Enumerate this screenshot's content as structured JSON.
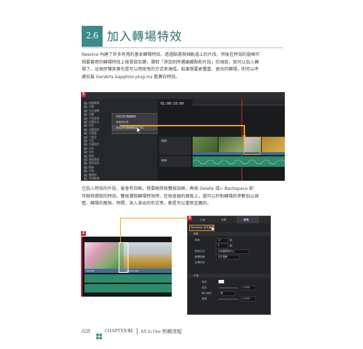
{
  "section": {
    "number": "2.6",
    "title": "加入轉場特效"
  },
  "paragraph1": [
    "Resolve 內建了許多有用的基本轉場特效。透過點選視頻軌道上的片段，然後在特效的窗格中",
    "想要套用的轉場特效上按滑鼠右鍵，選取「添加到所選編輯點和片段」的項目，就可以加入轉",
    "場了。這個步驟其實也是可以用拖曳的方式來達成。如果想要更豐富、更炫的轉場，則可以考",
    "慮安裝 GenArts Sapphire plug-ins 藍寶石特效。"
  ],
  "paragraph2": [
    "已加入特效的片段，後會有白框。想要刪除就雙按該框，再按 Delete 或← Backspace 即",
    "可刪除選取的特效。雙按選取轉場特效時，在檢查器的面板上，還可以針對轉場的參數加以調",
    "整，轉場的風格、時間、漸入漸出的形式等，都是可以重新定義的。"
  ],
  "figure1": {
    "tag": "1",
    "timecode": "01:00:10:00",
    "effects_list": [
      "視頻轉場",
      "光圈",
      "交叉溶解",
      "光圈",
      "平滑剪接",
      "光圈交叉",
      "形狀",
      "光圈形狀",
      "百葉窗",
      "三角形",
      "方形",
      "光圈形狀",
      "方形",
      "交叉",
      "擦除",
      "邊緣擦除",
      "擦除形狀",
      "推移",
      "分割",
      "雙擦除",
      "音頻轉場"
    ],
    "context_menu": [
      "添加到所選編輯點",
      "添加到片段",
      "添加到所選編輯點和片段"
    ],
    "track_v1": "視頻1",
    "track_a1": "音頻1",
    "clip_label": "Transitions"
  },
  "figure2": {
    "tag": "2",
    "clip_a": "Clip 001",
    "clip_b": "Autumn 001",
    "cross_label": "交叉溶解"
  },
  "figure3": {
    "tag": "3",
    "tabs": [
      "片段",
      "效果",
      "轉場"
    ],
    "transition_name": "Transition 交叉溶解",
    "section_video": "視頻",
    "rows": [
      {
        "label": "時長",
        "value": "12",
        "unit": "幀"
      },
      {
        "label": "",
        "value": "0",
        "unit": "幀"
      },
      {
        "label": "對齊方式",
        "value": "以剪接點為中心"
      },
      {
        "label": "轉場風格",
        "value": "交叉溶解"
      },
      {
        "label": "反轉特效",
        "value": ""
      }
    ],
    "section_smooth": "平滑",
    "rows2": [
      {
        "label": "色彩",
        "value": ""
      },
      {
        "label": "混合",
        "value": "0.000"
      },
      {
        "label": "緩入緩出",
        "value": "無"
      },
      {
        "label": "邊框",
        "value": "0.000"
      }
    ]
  },
  "footer": {
    "page": "028",
    "chapter": "CHAPTER",
    "chapter_num": "02",
    "title": "All in One 剪輯流程"
  }
}
